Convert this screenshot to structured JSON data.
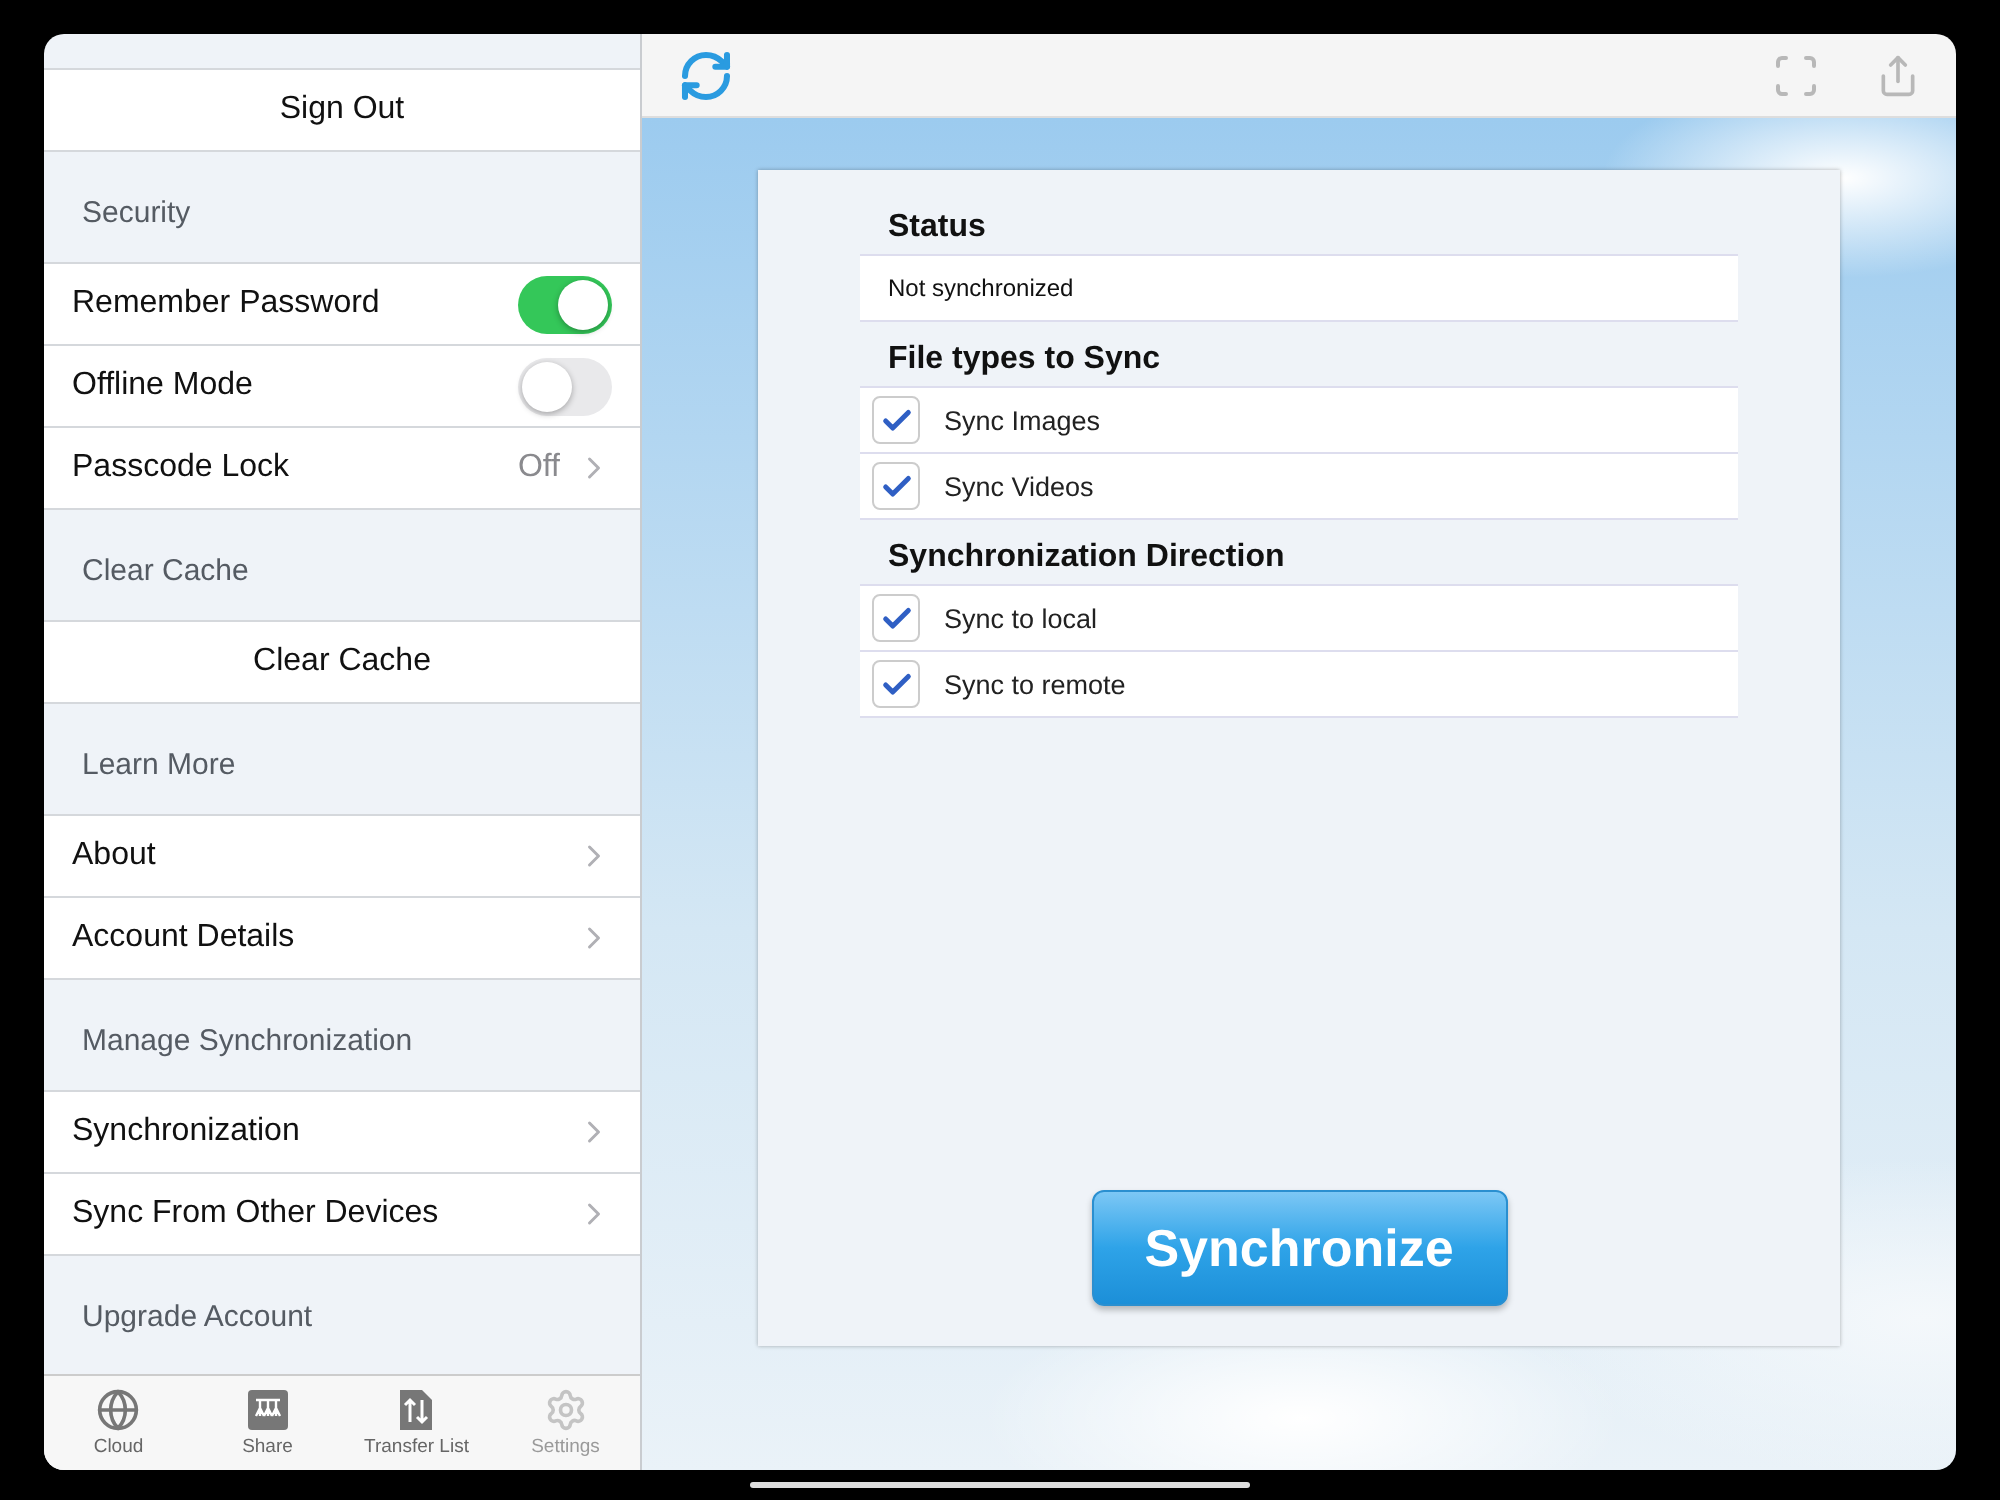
{
  "sidebar": {
    "sections": [
      {
        "rows": [
          {
            "kind": "button",
            "label": "Sign Out"
          }
        ]
      },
      {
        "header": "Security",
        "rows": [
          {
            "kind": "toggle",
            "label": "Remember Password",
            "on": true
          },
          {
            "kind": "toggle",
            "label": "Offline Mode",
            "on": false
          },
          {
            "kind": "value",
            "label": "Passcode Lock",
            "value": "Off"
          }
        ]
      },
      {
        "header": "Clear Cache",
        "rows": [
          {
            "kind": "button",
            "label": "Clear Cache"
          }
        ]
      },
      {
        "header": "Learn More",
        "rows": [
          {
            "kind": "link",
            "label": "About"
          },
          {
            "kind": "link",
            "label": "Account Details"
          }
        ]
      },
      {
        "header": "Manage Synchronization",
        "rows": [
          {
            "kind": "link",
            "label": "Synchronization"
          },
          {
            "kind": "link",
            "label": "Sync From Other Devices"
          }
        ]
      },
      {
        "header": "Upgrade Account"
      }
    ]
  },
  "tab_bar": [
    {
      "label": "Cloud",
      "selected": false
    },
    {
      "label": "Share",
      "selected": false
    },
    {
      "label": "Transfer List",
      "selected": false
    },
    {
      "label": "Settings",
      "selected": true
    }
  ],
  "sync_panel": {
    "status_header": "Status",
    "status": "Not synchronized",
    "groups": [
      {
        "header": "File types to Sync",
        "options": [
          {
            "label": "Sync Images",
            "checked": true
          },
          {
            "label": "Sync Videos",
            "checked": true
          }
        ]
      },
      {
        "header": "Synchronization Direction",
        "options": [
          {
            "label": "Sync to local",
            "checked": true
          },
          {
            "label": "Sync to remote",
            "checked": true
          }
        ]
      }
    ],
    "button": "Synchronize"
  }
}
